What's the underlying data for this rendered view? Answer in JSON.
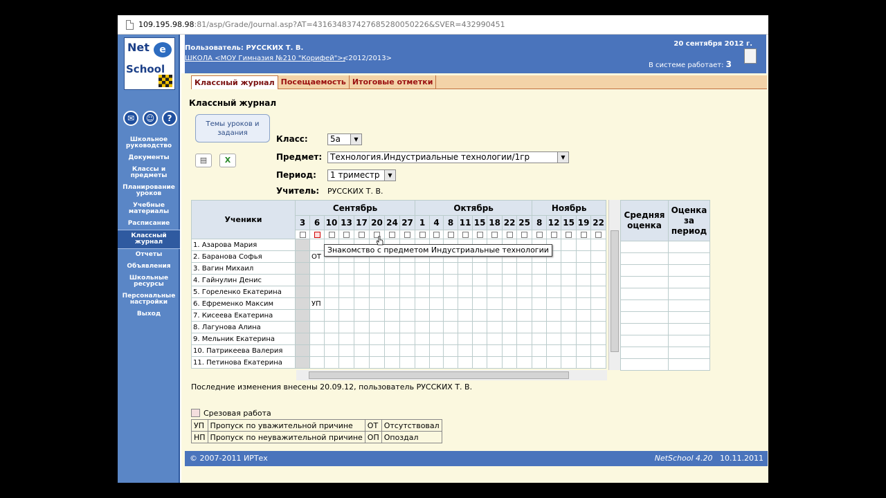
{
  "browser": {
    "url_host": "109.195.98.98",
    "url_rest": ":81/asp/Grade/Journal.asp?AT=431634837427685280050226&SVER=432990451"
  },
  "logo": {
    "line1": "Net",
    "line2": "School"
  },
  "sidebar": {
    "icons": [
      "mail-icon",
      "users-icon",
      "help-icon"
    ],
    "items": [
      {
        "label": "Школьное руководство"
      },
      {
        "label": "Документы"
      },
      {
        "label": "Классы и предметы"
      },
      {
        "label": "Планирование уроков"
      },
      {
        "label": "Учебные материалы"
      },
      {
        "label": "Расписание"
      },
      {
        "label": "Классный журнал",
        "active": true
      },
      {
        "label": "Отчеты"
      },
      {
        "label": "Объявления"
      },
      {
        "label": "Школьные ресурсы"
      },
      {
        "label": "Персональные настройки"
      },
      {
        "label": "Выход"
      }
    ]
  },
  "header": {
    "user": "Пользователь: РУССКИХ Т. В.",
    "school": "ШКОЛА <МОУ Гимназия №210 \"Корифей\">,",
    "year": "<2012/2013>",
    "date": "20 сентября 2012 г.",
    "online_label": "В системе работает:",
    "online_count": "3"
  },
  "tabs": [
    {
      "label": "Классный журнал",
      "active": true
    },
    {
      "label": "Посещаемость"
    },
    {
      "label": "Итоговые отметки"
    }
  ],
  "page": {
    "title": "Классный журнал",
    "topics_button": "Темы уроков и задания",
    "class_label": "Класс:",
    "class_value": "5а",
    "subject_label": "Предмет:",
    "subject_value": "Технология.Индустриальные технологии/1гр",
    "period_label": "Период:",
    "period_value": "1 триместр",
    "teacher_label": "Учитель:",
    "teacher_value": "РУССКИХ Т. В."
  },
  "journal": {
    "students_header": "Ученики",
    "months": [
      {
        "name": "Сентябрь",
        "span": 8
      },
      {
        "name": "Октябрь",
        "span": 8
      },
      {
        "name": "Ноябрь",
        "span": 5
      }
    ],
    "days": [
      "3",
      "6",
      "10",
      "13",
      "17",
      "20",
      "24",
      "27",
      "1",
      "4",
      "8",
      "11",
      "15",
      "18",
      "22",
      "25",
      "8",
      "12",
      "15",
      "19",
      "22"
    ],
    "students": [
      {
        "name": "1. Азарова Мария",
        "marks": {}
      },
      {
        "name": "2. Баранова Софья",
        "marks": {
          "1": "ОТ"
        }
      },
      {
        "name": "3. Вагин Михаил",
        "marks": {}
      },
      {
        "name": "4. Гайнулин Денис",
        "marks": {}
      },
      {
        "name": "5. Гореленко Екатерина",
        "marks": {}
      },
      {
        "name": "6. Ефременко Максим",
        "marks": {
          "1": "УП"
        }
      },
      {
        "name": "7. Кисеева Екатерина",
        "marks": {}
      },
      {
        "name": "8. Лагунова Алина",
        "marks": {}
      },
      {
        "name": "9. Мельник Екатерина",
        "marks": {}
      },
      {
        "name": "10. Патрикеева Валерия",
        "marks": {}
      },
      {
        "name": "11. Петинова Екатерина",
        "marks": {}
      }
    ],
    "avg_header": "Средняя оценка",
    "period_header": "Оценка за период",
    "tooltip": "Знакомство с предметом Индустриальные технологии"
  },
  "last_change": "Последние изменения внесены 20.09.12, пользователь РУССКИХ Т. В.",
  "legend": {
    "cut": "Срезовая работа",
    "rows": [
      [
        "УП",
        "Пропуск по уважительной причине",
        "ОТ",
        "Отсутствовал"
      ],
      [
        "НП",
        "Пропуск по неуважительной причине",
        "ОП",
        "Опоздал"
      ]
    ]
  },
  "footer": {
    "copyright": "© 2007-2011 ИРТех",
    "product": "NetSchool 4.20",
    "build_date": "10.11.2011"
  },
  "colors": {
    "sidebar": "#5a86c6",
    "header": "#4a74bc",
    "content": "#fbf8df",
    "tab_bar": "#f3d3a8",
    "tab_text": "#9a1010"
  }
}
